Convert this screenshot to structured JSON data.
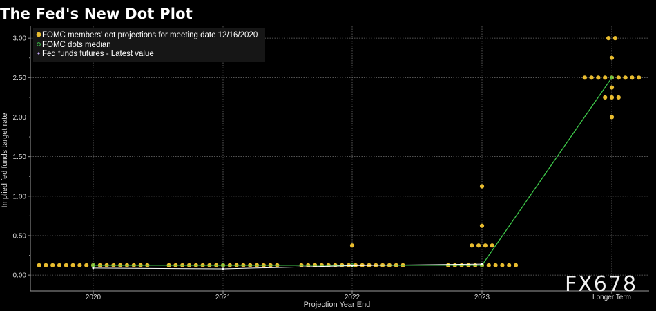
{
  "page": {
    "title": "The Fed's New Dot Plot",
    "watermark": "FX678"
  },
  "colors": {
    "background": "#000000",
    "dots": "#e9bd2f",
    "median_line": "#3ec64a",
    "futures_line": "#ffffff",
    "grid": "#6f6f6f",
    "axis": "#9a9a9a",
    "legend_bg": "#161616"
  },
  "chart_data": {
    "type": "scatter",
    "title": "The Fed's New Dot Plot",
    "xlabel": "Projection Year End",
    "ylabel": "Implied fed funds target rate",
    "categories": [
      "2020",
      "2021",
      "2022",
      "2023",
      "Longer Term"
    ],
    "ylim": [
      -0.2,
      3.15
    ],
    "yticks": [
      0,
      0.5,
      1.0,
      1.5,
      2.0,
      2.5,
      3.0
    ],
    "ytick_labels": [
      "0.00",
      "0.50",
      "1.00",
      "1.50",
      "2.00",
      "2.50",
      "3.00"
    ],
    "grid": true,
    "legend_position": "top-left",
    "legend": [
      {
        "label": "FOMC members' dot projections for meeting date 12/16/2020",
        "marker": "dot"
      },
      {
        "label": "FOMC dots median",
        "marker": "ring"
      },
      {
        "label": "Fed funds futures - Latest value",
        "marker": "diamond"
      }
    ],
    "series": [
      {
        "name": "FOMC members' dot projections for meeting date 12/16/2020",
        "kind": "dots",
        "groups": [
          {
            "category": "2020",
            "values": [
              [
                0.125,
                17
              ]
            ]
          },
          {
            "category": "2021",
            "values": [
              [
                0.125,
                17
              ]
            ]
          },
          {
            "category": "2022",
            "values": [
              [
                0.125,
                16
              ],
              [
                0.375,
                1
              ]
            ]
          },
          {
            "category": "2023",
            "values": [
              [
                0.125,
                11
              ],
              [
                0.375,
                4
              ],
              [
                0.625,
                1
              ],
              [
                1.125,
                1
              ]
            ]
          },
          {
            "category": "Longer Term",
            "values": [
              [
                2.0,
                1
              ],
              [
                2.25,
                3
              ],
              [
                2.375,
                1
              ],
              [
                2.5,
                9
              ],
              [
                2.75,
                1
              ],
              [
                3.0,
                2
              ]
            ]
          }
        ]
      },
      {
        "name": "FOMC dots median",
        "kind": "line",
        "values": [
          0.125,
          0.125,
          0.125,
          0.125,
          2.5
        ]
      },
      {
        "name": "Fed funds futures - Latest value",
        "kind": "line",
        "values": [
          0.09,
          0.08,
          0.12,
          0.14
        ]
      }
    ]
  }
}
